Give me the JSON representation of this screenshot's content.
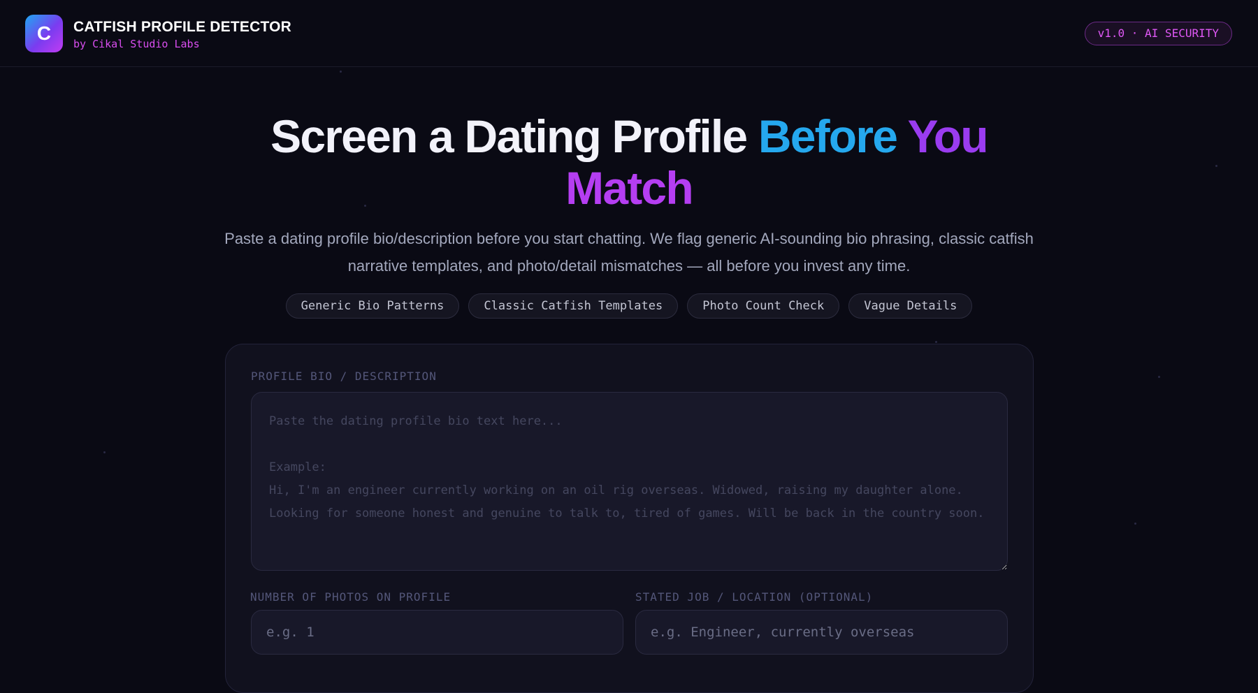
{
  "header": {
    "logo_letter": "C",
    "title": "CATFISH PROFILE DETECTOR",
    "subtitle": "by Cikal Studio Labs",
    "version_badge": "v1.0 · AI SECURITY"
  },
  "hero": {
    "title_part1": "Screen a Dating Profile ",
    "title_part2": "Before ",
    "title_part3": "You",
    "title_part4": "Match",
    "description": "Paste a dating profile bio/description before you start chatting. We flag generic AI-sounding bio phrasing, classic catfish narrative templates, and photo/detail mismatches — all before you invest any time."
  },
  "chips": [
    "Generic Bio Patterns",
    "Classic Catfish Templates",
    "Photo Count Check",
    "Vague Details"
  ],
  "form": {
    "bio_label": "PROFILE BIO / DESCRIPTION",
    "bio_placeholder": "Paste the dating profile bio text here...\n\nExample:\nHi, I'm an engineer currently working on an oil rig overseas. Widowed, raising my daughter alone. Looking for someone honest and genuine to talk to, tired of games. Will be back in the country soon.",
    "photos_label": "NUMBER OF PHOTOS ON PROFILE",
    "photos_placeholder": "e.g. 1",
    "job_label": "STATED JOB / LOCATION (OPTIONAL)",
    "job_placeholder": "e.g. Engineer, currently overseas"
  },
  "colors": {
    "background": "#0a0a14",
    "accent_pink": "#d94ef0",
    "accent_blue": "#25a8ee",
    "accent_purple": "#9a3cf0"
  }
}
